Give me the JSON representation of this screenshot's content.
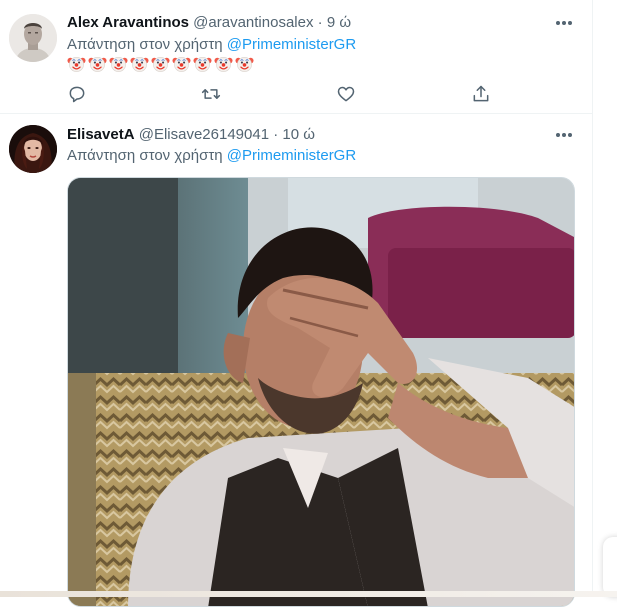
{
  "tweets": [
    {
      "name": "Alex Aravantinos",
      "handle": "@aravantinosalex",
      "separator": "·",
      "time": "9 ώ",
      "reply_prefix": "Απάντηση στον χρήστη",
      "reply_mention": "@PrimeministerGR",
      "emoji_count": 9,
      "emoji_icon": "clown-face-icon"
    },
    {
      "name": "ElisavetA",
      "handle": "@Elisave26149041",
      "separator": "·",
      "time": "10 ώ",
      "reply_prefix": "Απάντηση στον χρήστη",
      "reply_mention": "@PrimeministerGR",
      "media_icon": "gif-image"
    }
  ],
  "action_icons": [
    "reply-icon",
    "retweet-icon",
    "like-icon",
    "share-icon"
  ],
  "colors": {
    "accent": "#1d9bf0",
    "secondary_text": "#536471",
    "primary_text": "#0f1419",
    "divider": "#eff3f4"
  }
}
